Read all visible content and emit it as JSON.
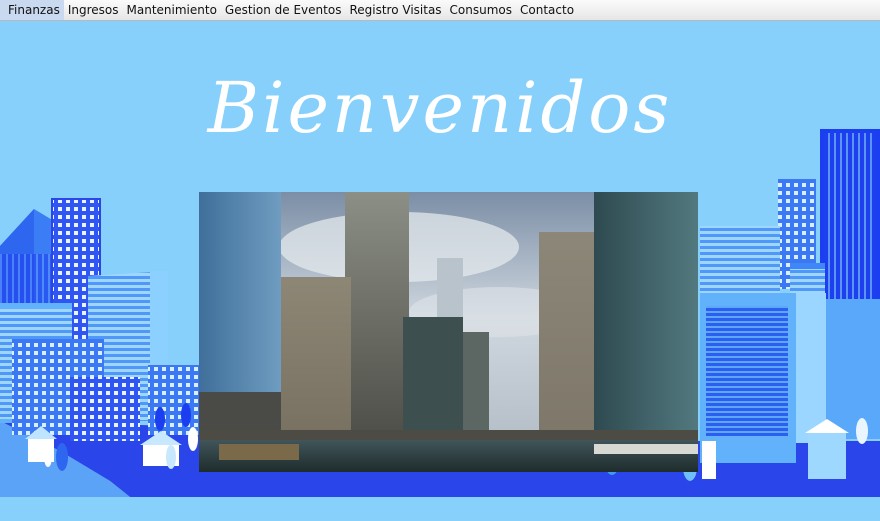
{
  "menu": {
    "items": [
      {
        "label": "Finanzas"
      },
      {
        "label": "Ingresos"
      },
      {
        "label": "Mantenimiento"
      },
      {
        "label": "Gestion de Eventos"
      },
      {
        "label": "Registro Visitas"
      },
      {
        "label": "Consumos"
      },
      {
        "label": "Contacto"
      }
    ]
  },
  "main": {
    "greeting": "Bienvenidos"
  },
  "colors": {
    "sky": "#86d0fb",
    "building_dark": "#1b3ff0",
    "building_mid": "#3a7df5",
    "building_light": "#62b2fb",
    "ground": "#2a46ea"
  }
}
